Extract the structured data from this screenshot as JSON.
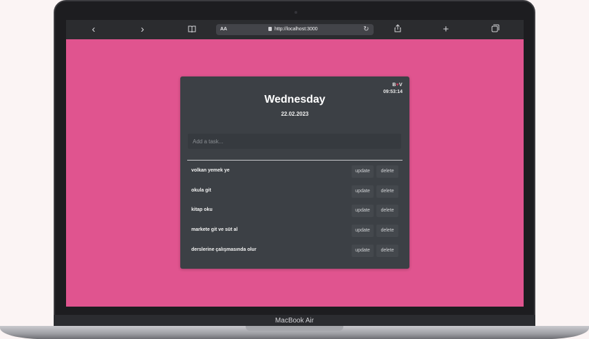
{
  "browser": {
    "back_icon": "‹",
    "forward_icon": "›",
    "reader_icon": "book-icon",
    "aa_label": "AA",
    "url": "http://localhost:3000",
    "reload_icon": "↻",
    "share_icon": "share-icon",
    "new_tab_icon": "+",
    "tabs_icon": "tabs-icon"
  },
  "app": {
    "brand_left": "B",
    "brand_heart": "♥",
    "brand_right": "V",
    "clock": "09:53:14",
    "day": "Wednesday",
    "date": "22.02.2023",
    "input_placeholder": "Add a task...",
    "tasks": [
      {
        "label": "volkan yemek ye",
        "update": "update",
        "delete": "delete"
      },
      {
        "label": "okula git",
        "update": "update",
        "delete": "delete"
      },
      {
        "label": "kitap oku",
        "update": "update",
        "delete": "delete"
      },
      {
        "label": "markete git ve süt al",
        "update": "update",
        "delete": "delete"
      },
      {
        "label": "derslerine çalışmasında olur",
        "update": "update",
        "delete": "delete"
      }
    ]
  },
  "device": {
    "label": "MacBook Air"
  },
  "colors": {
    "page_background": "#e0548f",
    "card": "#3c4045",
    "browser_bar": "#2b2c2f"
  }
}
